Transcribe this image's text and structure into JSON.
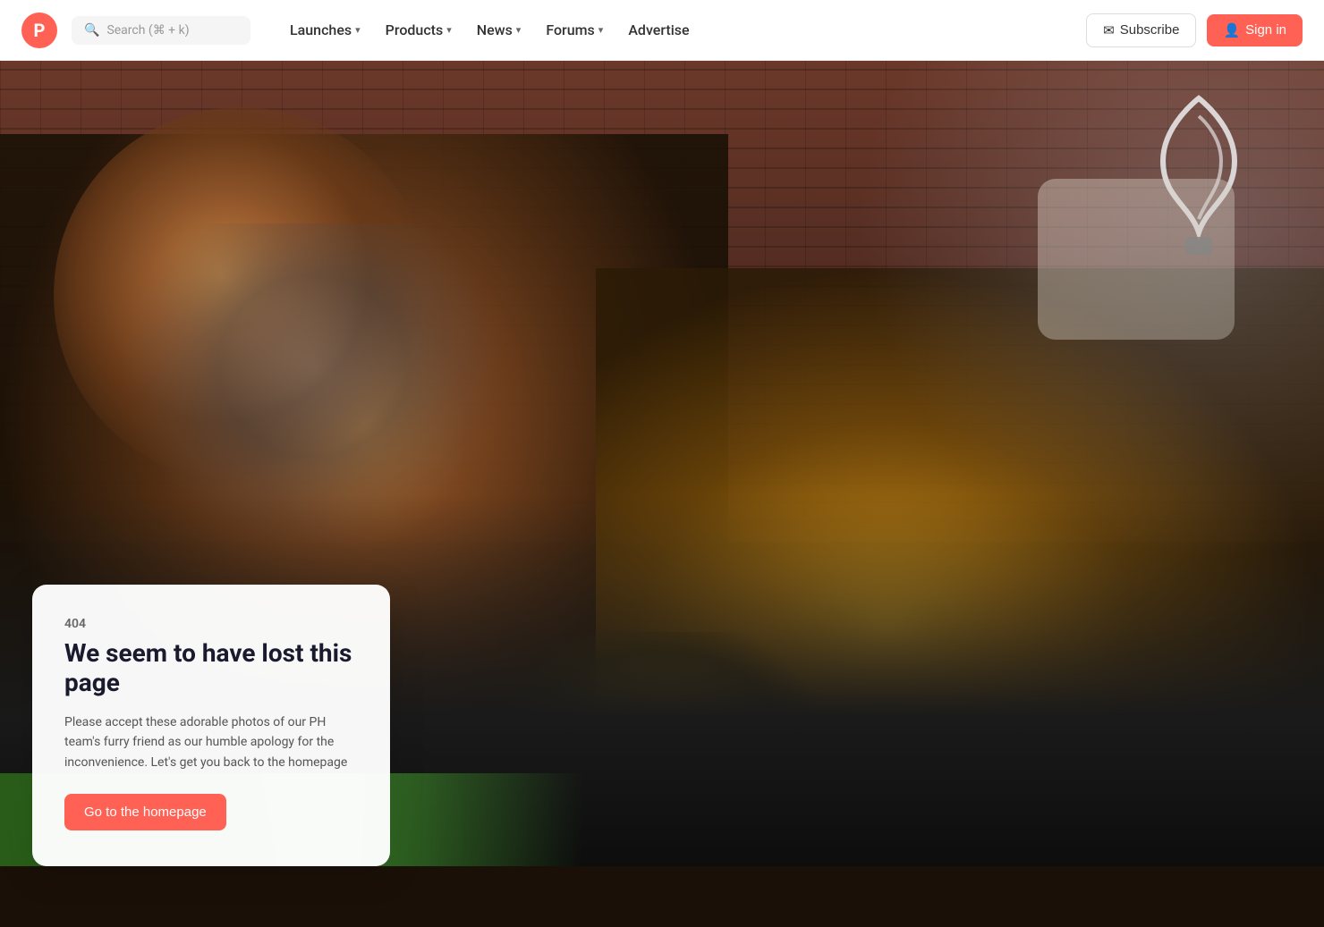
{
  "nav": {
    "logo_letter": "P",
    "search_placeholder": "Search (⌘ + k)",
    "links": [
      {
        "label": "Launches",
        "has_dropdown": true
      },
      {
        "label": "Products",
        "has_dropdown": true
      },
      {
        "label": "News",
        "has_dropdown": true
      },
      {
        "label": "Forums",
        "has_dropdown": true
      },
      {
        "label": "Advertise",
        "has_dropdown": false
      }
    ],
    "subscribe_label": "Subscribe",
    "signin_label": "Sign in"
  },
  "error": {
    "code": "404",
    "title": "We seem to have lost this page",
    "description": "Please accept these adorable photos of our PH team's furry friend as our humble apology for the inconvenience. Let's get you back to the homepage",
    "cta_label": "Go to the homepage"
  },
  "colors": {
    "brand": "#ff6154",
    "text_dark": "#1a1a2e",
    "text_muted": "#555"
  }
}
